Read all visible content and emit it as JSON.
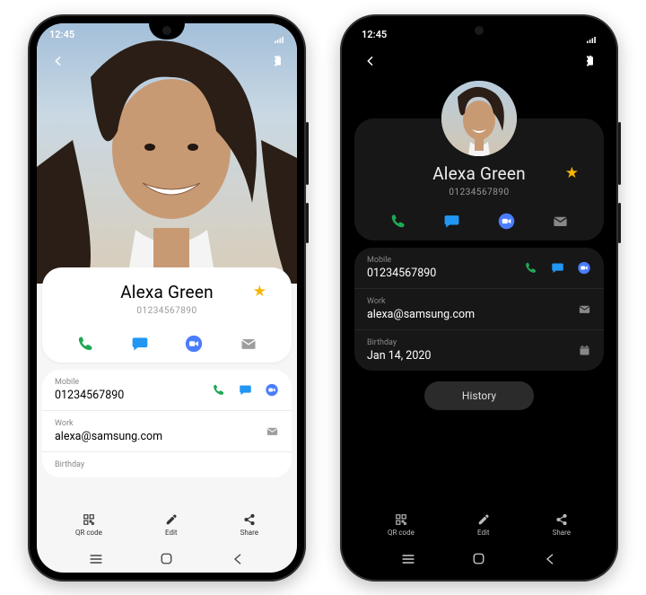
{
  "status": {
    "time": "12:45"
  },
  "contact": {
    "name": "Alexa Green",
    "number": "01234567890",
    "mobile_label": "Mobile",
    "mobile_value": "01234567890",
    "work_label": "Work",
    "work_value": "alexa@samsung.com",
    "birthday_label": "Birthday",
    "birthday_value": "Jan 14, 2020"
  },
  "actions": {
    "call": "Call",
    "message": "Message",
    "video": "Video",
    "email": "Email"
  },
  "history_label": "History",
  "bottom": {
    "qr": "QR code",
    "edit": "Edit",
    "share": "Share"
  },
  "colors": {
    "call": "#1fa855",
    "message": "#2196f3",
    "video": "#4a7dff",
    "email": "#9e9e9e",
    "star": "#f7b500"
  }
}
